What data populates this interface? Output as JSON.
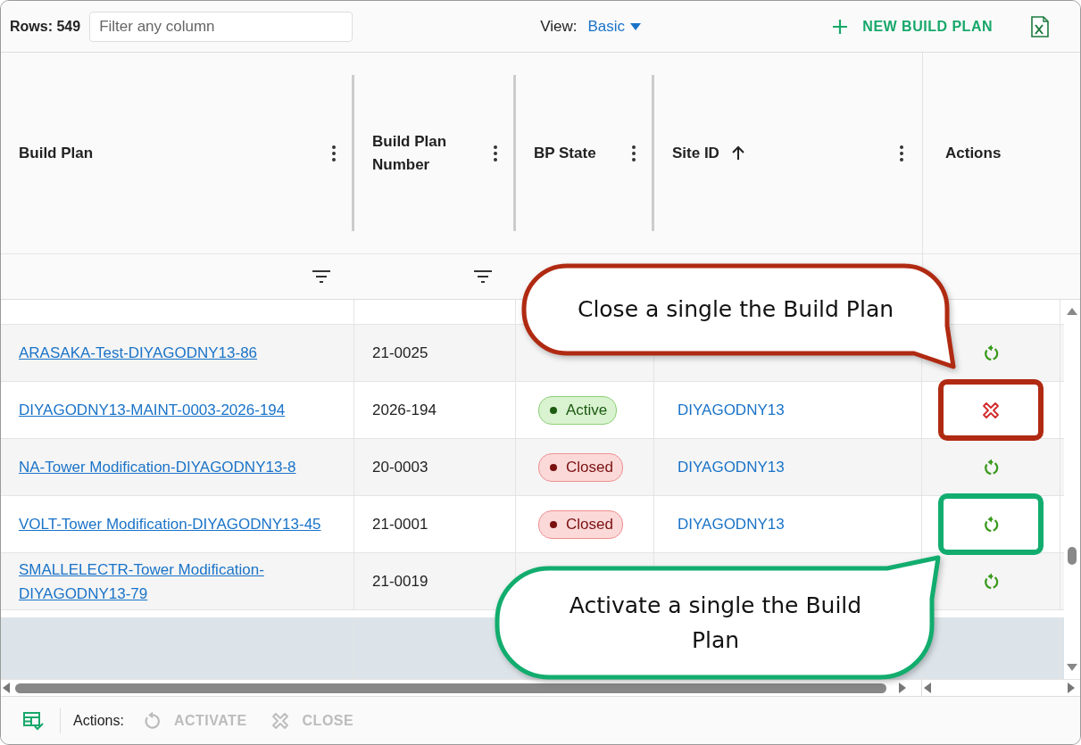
{
  "toolbar": {
    "rows_label": "Rows: 549",
    "filter_placeholder": "Filter any column",
    "view_label": "View:",
    "view_value": "Basic",
    "new_button": "NEW BUILD PLAN"
  },
  "columns": [
    {
      "label": "Build Plan",
      "menu": true,
      "filter": true,
      "sorted": false
    },
    {
      "label": "Build Plan Number",
      "menu": true,
      "filter": true,
      "sorted": false
    },
    {
      "label": "BP State",
      "menu": true,
      "filter": false,
      "sorted": false
    },
    {
      "label": "Site ID",
      "menu": true,
      "filter": false,
      "sorted": true
    },
    {
      "label": "Actions",
      "menu": false,
      "filter": false,
      "sorted": false
    }
  ],
  "rows": [
    {
      "name": "ARASAKA-Test-DIYAGODNY13-86",
      "number": "21-0025",
      "action": {
        "kind": "activate"
      }
    },
    {
      "name": "DIYAGODNY13-MAINT-0003-2026-194",
      "number": "2026-194",
      "state": {
        "label": "Active",
        "kind": "active"
      },
      "site": "DIYAGODNY13",
      "action": {
        "kind": "close"
      },
      "highlight": {
        "color": "#b02a12"
      }
    },
    {
      "name": "NA-Tower Modification-DIYAGODNY13-8",
      "number": "20-0003",
      "state": {
        "label": "Closed",
        "kind": "closed"
      },
      "site": "DIYAGODNY13",
      "action": {
        "kind": "activate"
      }
    },
    {
      "name": "VOLT-Tower Modification-DIYAGODNY13-45",
      "number": "21-0001",
      "state": {
        "label": "Closed",
        "kind": "closed"
      },
      "site": "DIYAGODNY13",
      "action": {
        "kind": "activate"
      },
      "highlight": {
        "color": "#12ad6e"
      }
    },
    {
      "name": "SMALLELECTR-Tower Modification-DIYAGODNY13-79",
      "number": "21-0019",
      "action": {
        "kind": "activate"
      }
    }
  ],
  "callouts": [
    {
      "text": "Close a single the Build Plan",
      "color": "#b02a12",
      "kind": "down"
    },
    {
      "text": "Activate a single the Build Plan",
      "color": "#12ad6e",
      "kind": "up"
    }
  ],
  "footer": {
    "label": "Actions:",
    "buttons": [
      {
        "label": "ACTIVATE",
        "kind": "activate",
        "disabled": true
      },
      {
        "label": "CLOSE",
        "kind": "close",
        "disabled": true
      }
    ]
  }
}
